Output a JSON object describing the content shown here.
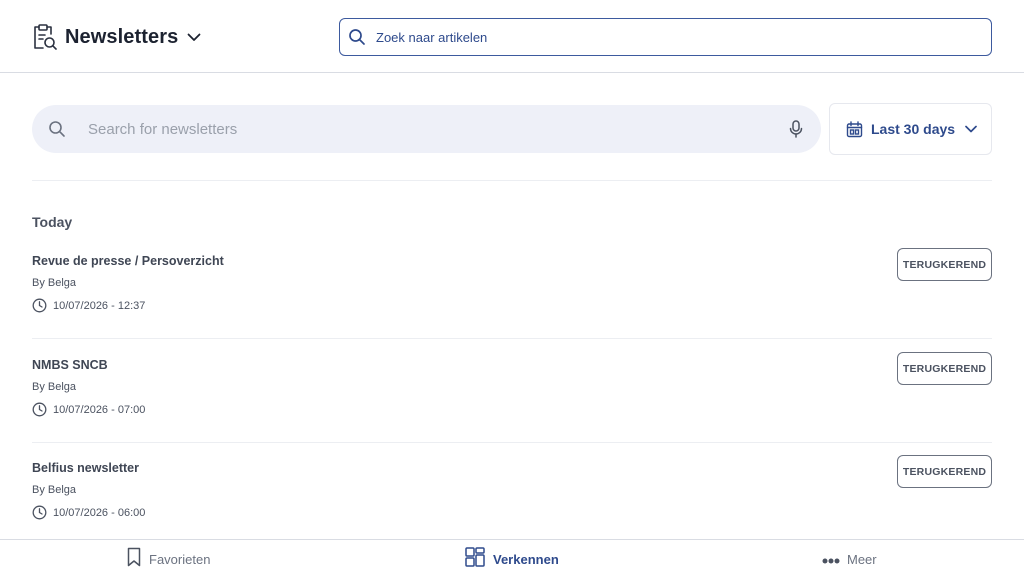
{
  "header": {
    "title": "Newsletters",
    "search_placeholder": "Zoek naar artikelen"
  },
  "filters": {
    "search_placeholder": "Search for newsletters",
    "date_range": "Last 30 days"
  },
  "section": {
    "title": "Today"
  },
  "newsletters": [
    {
      "title": "Revue de presse / Persoverzicht",
      "by": "By Belga",
      "datetime": "10/07/2026 - 12:37",
      "badge": "TERUGKEREND"
    },
    {
      "title": "NMBS SNCB",
      "by": "By Belga",
      "datetime": "10/07/2026 - 07:00",
      "badge": "TERUGKEREND"
    },
    {
      "title": "Belfius newsletter",
      "by": "By Belga",
      "datetime": "10/07/2026 - 06:00",
      "badge": "TERUGKEREND"
    }
  ],
  "bottom_nav": {
    "items": [
      {
        "label": "Favorieten",
        "icon": "bookmark-icon"
      },
      {
        "label": "Verkennen",
        "icon": "explore-grid-icon",
        "active": true
      },
      {
        "label": "Meer",
        "icon": "more-dots-icon"
      }
    ]
  },
  "colors": {
    "accent": "#2e4a8c",
    "search_bg": "#eef0f8",
    "text_muted": "#4b5260"
  }
}
